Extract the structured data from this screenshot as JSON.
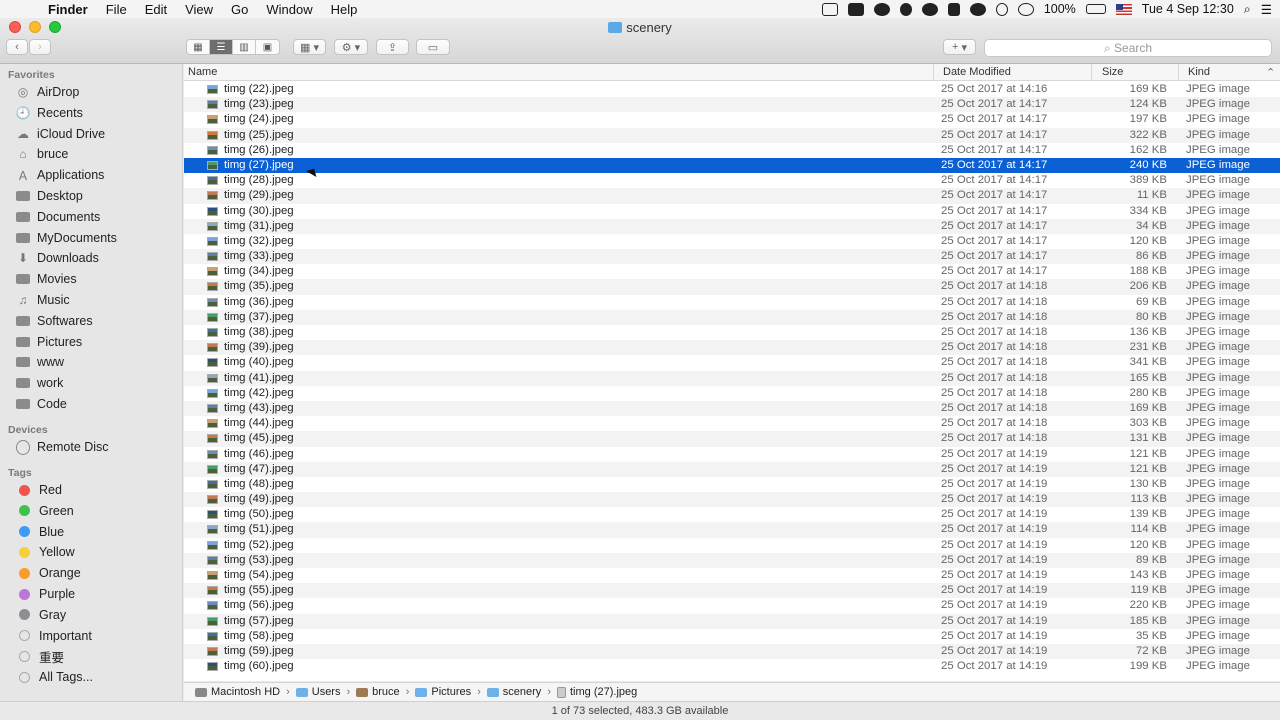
{
  "menubar": {
    "app_name": "Finder",
    "menus": [
      "File",
      "Edit",
      "View",
      "Go",
      "Window",
      "Help"
    ],
    "battery": "100%",
    "datetime": "Tue 4 Sep  12:30"
  },
  "window": {
    "title": "scenery",
    "search_placeholder": "Search",
    "add_label": "+"
  },
  "sidebar": {
    "favorites_header": "Favorites",
    "favorites": [
      {
        "label": "AirDrop",
        "icon": "airdrop-icon"
      },
      {
        "label": "Recents",
        "icon": "recents-icon"
      },
      {
        "label": "iCloud Drive",
        "icon": "cloud-icon"
      },
      {
        "label": "bruce",
        "icon": "home-icon"
      },
      {
        "label": "Applications",
        "icon": "applications-icon"
      },
      {
        "label": "Desktop",
        "icon": "desktop-icon"
      },
      {
        "label": "Documents",
        "icon": "documents-icon"
      },
      {
        "label": "MyDocuments",
        "icon": "folder-icon"
      },
      {
        "label": "Downloads",
        "icon": "downloads-icon"
      },
      {
        "label": "Movies",
        "icon": "movies-icon"
      },
      {
        "label": "Music",
        "icon": "music-icon"
      },
      {
        "label": "Softwares",
        "icon": "folder-icon"
      },
      {
        "label": "Pictures",
        "icon": "pictures-icon"
      },
      {
        "label": "www",
        "icon": "folder-icon"
      },
      {
        "label": "work",
        "icon": "folder-icon"
      },
      {
        "label": "Code",
        "icon": "folder-icon"
      }
    ],
    "devices_header": "Devices",
    "devices": [
      {
        "label": "Remote Disc",
        "icon": "disc-icon"
      }
    ],
    "tags_header": "Tags",
    "tags": [
      {
        "label": "Red",
        "color": "#f4524e"
      },
      {
        "label": "Green",
        "color": "#3fc24c"
      },
      {
        "label": "Blue",
        "color": "#3d9af5"
      },
      {
        "label": "Yellow",
        "color": "#f8cf36"
      },
      {
        "label": "Orange",
        "color": "#f89d2c"
      },
      {
        "label": "Purple",
        "color": "#bd75d9"
      },
      {
        "label": "Gray",
        "color": "#8e8e92"
      },
      {
        "label": "Important",
        "color": ""
      },
      {
        "label": "重要",
        "color": ""
      },
      {
        "label": "All Tags...",
        "color": ""
      }
    ]
  },
  "columns": {
    "name": "Name",
    "date": "Date Modified",
    "size": "Size",
    "kind": "Kind"
  },
  "files": [
    {
      "name": "timg (22).jpeg",
      "date": "25 Oct 2017 at 14:16",
      "size": "169 KB",
      "kind": "JPEG image"
    },
    {
      "name": "timg (23).jpeg",
      "date": "25 Oct 2017 at 14:17",
      "size": "124 KB",
      "kind": "JPEG image"
    },
    {
      "name": "timg (24).jpeg",
      "date": "25 Oct 2017 at 14:17",
      "size": "197 KB",
      "kind": "JPEG image"
    },
    {
      "name": "timg (25).jpeg",
      "date": "25 Oct 2017 at 14:17",
      "size": "322 KB",
      "kind": "JPEG image"
    },
    {
      "name": "timg (26).jpeg",
      "date": "25 Oct 2017 at 14:17",
      "size": "162 KB",
      "kind": "JPEG image"
    },
    {
      "name": "timg (27).jpeg",
      "date": "25 Oct 2017 at 14:17",
      "size": "240 KB",
      "kind": "JPEG image"
    },
    {
      "name": "timg (28).jpeg",
      "date": "25 Oct 2017 at 14:17",
      "size": "389 KB",
      "kind": "JPEG image"
    },
    {
      "name": "timg (29).jpeg",
      "date": "25 Oct 2017 at 14:17",
      "size": "11 KB",
      "kind": "JPEG image"
    },
    {
      "name": "timg (30).jpeg",
      "date": "25 Oct 2017 at 14:17",
      "size": "334 KB",
      "kind": "JPEG image"
    },
    {
      "name": "timg (31).jpeg",
      "date": "25 Oct 2017 at 14:17",
      "size": "34 KB",
      "kind": "JPEG image"
    },
    {
      "name": "timg (32).jpeg",
      "date": "25 Oct 2017 at 14:17",
      "size": "120 KB",
      "kind": "JPEG image"
    },
    {
      "name": "timg (33).jpeg",
      "date": "25 Oct 2017 at 14:17",
      "size": "86 KB",
      "kind": "JPEG image"
    },
    {
      "name": "timg (34).jpeg",
      "date": "25 Oct 2017 at 14:17",
      "size": "188 KB",
      "kind": "JPEG image"
    },
    {
      "name": "timg (35).jpeg",
      "date": "25 Oct 2017 at 14:18",
      "size": "206 KB",
      "kind": "JPEG image"
    },
    {
      "name": "timg (36).jpeg",
      "date": "25 Oct 2017 at 14:18",
      "size": "69 KB",
      "kind": "JPEG image"
    },
    {
      "name": "timg (37).jpeg",
      "date": "25 Oct 2017 at 14:18",
      "size": "80 KB",
      "kind": "JPEG image"
    },
    {
      "name": "timg (38).jpeg",
      "date": "25 Oct 2017 at 14:18",
      "size": "136 KB",
      "kind": "JPEG image"
    },
    {
      "name": "timg (39).jpeg",
      "date": "25 Oct 2017 at 14:18",
      "size": "231 KB",
      "kind": "JPEG image"
    },
    {
      "name": "timg (40).jpeg",
      "date": "25 Oct 2017 at 14:18",
      "size": "341 KB",
      "kind": "JPEG image"
    },
    {
      "name": "timg (41).jpeg",
      "date": "25 Oct 2017 at 14:18",
      "size": "165 KB",
      "kind": "JPEG image"
    },
    {
      "name": "timg (42).jpeg",
      "date": "25 Oct 2017 at 14:18",
      "size": "280 KB",
      "kind": "JPEG image"
    },
    {
      "name": "timg (43).jpeg",
      "date": "25 Oct 2017 at 14:18",
      "size": "169 KB",
      "kind": "JPEG image"
    },
    {
      "name": "timg (44).jpeg",
      "date": "25 Oct 2017 at 14:18",
      "size": "303 KB",
      "kind": "JPEG image"
    },
    {
      "name": "timg (45).jpeg",
      "date": "25 Oct 2017 at 14:18",
      "size": "131 KB",
      "kind": "JPEG image"
    },
    {
      "name": "timg (46).jpeg",
      "date": "25 Oct 2017 at 14:19",
      "size": "121 KB",
      "kind": "JPEG image"
    },
    {
      "name": "timg (47).jpeg",
      "date": "25 Oct 2017 at 14:19",
      "size": "121 KB",
      "kind": "JPEG image"
    },
    {
      "name": "timg (48).jpeg",
      "date": "25 Oct 2017 at 14:19",
      "size": "130 KB",
      "kind": "JPEG image"
    },
    {
      "name": "timg (49).jpeg",
      "date": "25 Oct 2017 at 14:19",
      "size": "113 KB",
      "kind": "JPEG image"
    },
    {
      "name": "timg (50).jpeg",
      "date": "25 Oct 2017 at 14:19",
      "size": "139 KB",
      "kind": "JPEG image"
    },
    {
      "name": "timg (51).jpeg",
      "date": "25 Oct 2017 at 14:19",
      "size": "114 KB",
      "kind": "JPEG image"
    },
    {
      "name": "timg (52).jpeg",
      "date": "25 Oct 2017 at 14:19",
      "size": "120 KB",
      "kind": "JPEG image"
    },
    {
      "name": "timg (53).jpeg",
      "date": "25 Oct 2017 at 14:19",
      "size": "89 KB",
      "kind": "JPEG image"
    },
    {
      "name": "timg (54).jpeg",
      "date": "25 Oct 2017 at 14:19",
      "size": "143 KB",
      "kind": "JPEG image"
    },
    {
      "name": "timg (55).jpeg",
      "date": "25 Oct 2017 at 14:19",
      "size": "119 KB",
      "kind": "JPEG image"
    },
    {
      "name": "timg (56).jpeg",
      "date": "25 Oct 2017 at 14:19",
      "size": "220 KB",
      "kind": "JPEG image"
    },
    {
      "name": "timg (57).jpeg",
      "date": "25 Oct 2017 at 14:19",
      "size": "185 KB",
      "kind": "JPEG image"
    },
    {
      "name": "timg (58).jpeg",
      "date": "25 Oct 2017 at 14:19",
      "size": "35 KB",
      "kind": "JPEG image"
    },
    {
      "name": "timg (59).jpeg",
      "date": "25 Oct 2017 at 14:19",
      "size": "72 KB",
      "kind": "JPEG image"
    },
    {
      "name": "timg (60).jpeg",
      "date": "25 Oct 2017 at 14:19",
      "size": "199 KB",
      "kind": "JPEG image"
    }
  ],
  "selected_file": "timg (27).jpeg",
  "path": [
    "Macintosh HD",
    "Users",
    "bruce",
    "Pictures",
    "scenery",
    "timg (27).jpeg"
  ],
  "status": "1 of 73 selected, 483.3 GB available",
  "colors": {
    "selection": "#0a60d4",
    "sidebar_bg": "#e6e6e6"
  }
}
